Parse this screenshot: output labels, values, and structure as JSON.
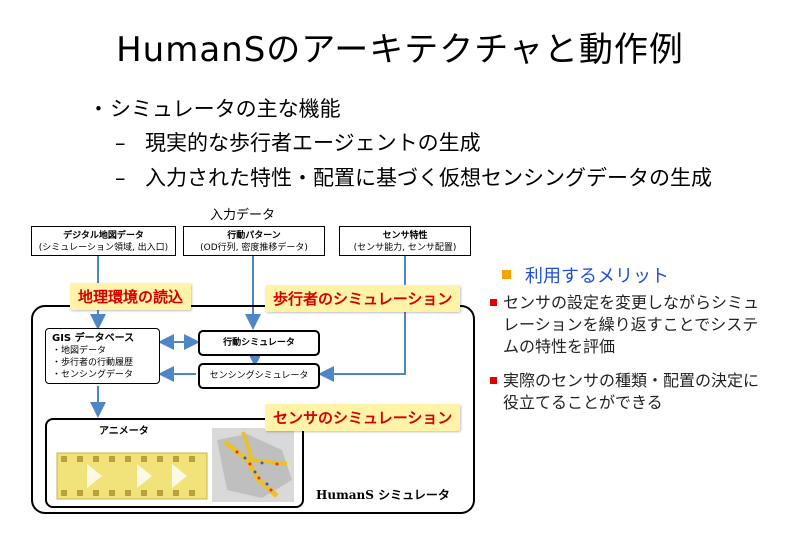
{
  "title": "HumanSのアーキテクチャと動作例",
  "bullet": "シミュレータの主な機能",
  "sub_bullets": [
    "現実的な歩行者エージェントの生成",
    "入力された特性・配置に基づく仮想センシングデータの生成"
  ],
  "diagram": {
    "input_label": "入力データ",
    "inputs": [
      {
        "name": "デジタル地図データ",
        "detail": "(シミュレーション領域, 出入口)"
      },
      {
        "name": "行動パターン",
        "detail": "(OD行列, 密度推移データ)"
      },
      {
        "name": "センサ特性",
        "detail": "(センサ能力, センサ配置)"
      }
    ],
    "gis": {
      "name": "GIS データベース",
      "items": [
        "・地図データ",
        "・歩行者の行動履歴",
        "・センシングデータ"
      ]
    },
    "behavior_sim": "行動シミュレータ",
    "sensing_sim": "センシングシミュレータ",
    "animator": "アニメータ",
    "simulator_name": "HumanS シミュレータ",
    "callouts": [
      "地理環境の読込",
      "歩行者のシミュレーション",
      "センサのシミュレーション"
    ]
  },
  "merits": {
    "heading": "利用するメリット",
    "items": [
      "センサの設定を変更しながらシミュレーションを繰り返すことでシステムの特性を評価",
      "実際のセンサの種類・配置の決定に役立てることができる"
    ]
  },
  "colors": {
    "accent_blue": "#1f4fd6",
    "arrow_blue": "#4f86c6",
    "callout_bg": "#fff3a8",
    "callout_text": "#d40000",
    "bullet_orange": "#f7a300",
    "bullet_red": "#e00000"
  }
}
